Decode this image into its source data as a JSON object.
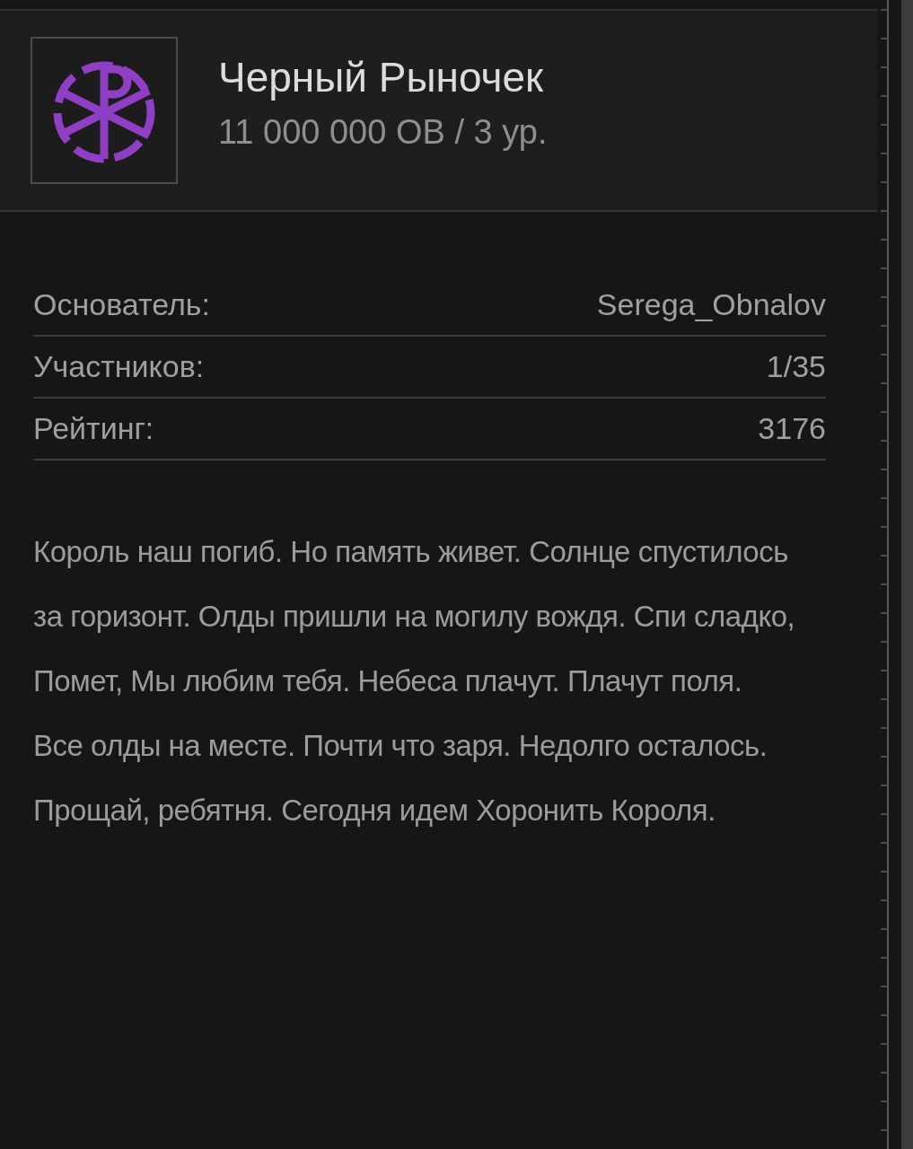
{
  "clan": {
    "name": "Черный Рыночек",
    "subtitle": "11 000 000 ОВ / 3 ур."
  },
  "stats": [
    {
      "label": "Основатель:",
      "value": "Serega_Obnalov"
    },
    {
      "label": "Участников:",
      "value": "1/35"
    },
    {
      "label": "Рейтинг:",
      "value": "3176"
    }
  ],
  "description": "Король наш погиб. Но память живет. Солнце спустилось за горизонт. Олды пришли на могилу вождя. Спи сладко, Помет, Мы любим тебя. Небеса плачут. Плачут поля. Все олды на месте. Почти что заря. Недолго осталось. Прощай, ребятня. Сегодня идем Хоронить Короля."
}
